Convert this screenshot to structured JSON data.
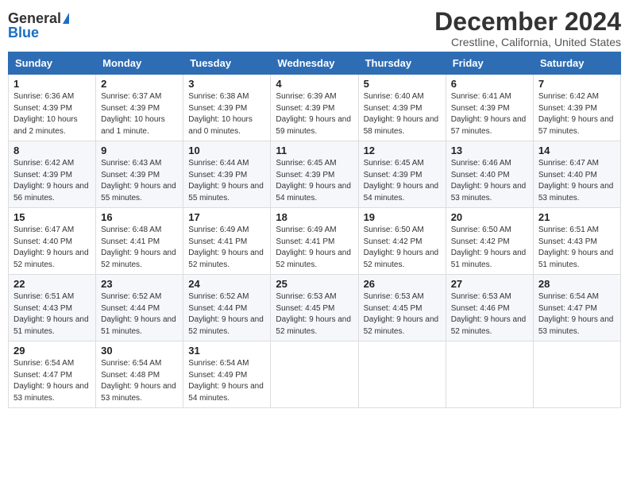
{
  "header": {
    "logo_general": "General",
    "logo_blue": "Blue",
    "month_title": "December 2024",
    "location": "Crestline, California, United States"
  },
  "days_of_week": [
    "Sunday",
    "Monday",
    "Tuesday",
    "Wednesday",
    "Thursday",
    "Friday",
    "Saturday"
  ],
  "weeks": [
    [
      {
        "day": 1,
        "sunrise": "6:36 AM",
        "sunset": "4:39 PM",
        "daylight": "10 hours and 2 minutes."
      },
      {
        "day": 2,
        "sunrise": "6:37 AM",
        "sunset": "4:39 PM",
        "daylight": "10 hours and 1 minute."
      },
      {
        "day": 3,
        "sunrise": "6:38 AM",
        "sunset": "4:39 PM",
        "daylight": "10 hours and 0 minutes."
      },
      {
        "day": 4,
        "sunrise": "6:39 AM",
        "sunset": "4:39 PM",
        "daylight": "9 hours and 59 minutes."
      },
      {
        "day": 5,
        "sunrise": "6:40 AM",
        "sunset": "4:39 PM",
        "daylight": "9 hours and 58 minutes."
      },
      {
        "day": 6,
        "sunrise": "6:41 AM",
        "sunset": "4:39 PM",
        "daylight": "9 hours and 57 minutes."
      },
      {
        "day": 7,
        "sunrise": "6:42 AM",
        "sunset": "4:39 PM",
        "daylight": "9 hours and 57 minutes."
      }
    ],
    [
      {
        "day": 8,
        "sunrise": "6:42 AM",
        "sunset": "4:39 PM",
        "daylight": "9 hours and 56 minutes."
      },
      {
        "day": 9,
        "sunrise": "6:43 AM",
        "sunset": "4:39 PM",
        "daylight": "9 hours and 55 minutes."
      },
      {
        "day": 10,
        "sunrise": "6:44 AM",
        "sunset": "4:39 PM",
        "daylight": "9 hours and 55 minutes."
      },
      {
        "day": 11,
        "sunrise": "6:45 AM",
        "sunset": "4:39 PM",
        "daylight": "9 hours and 54 minutes."
      },
      {
        "day": 12,
        "sunrise": "6:45 AM",
        "sunset": "4:39 PM",
        "daylight": "9 hours and 54 minutes."
      },
      {
        "day": 13,
        "sunrise": "6:46 AM",
        "sunset": "4:40 PM",
        "daylight": "9 hours and 53 minutes."
      },
      {
        "day": 14,
        "sunrise": "6:47 AM",
        "sunset": "4:40 PM",
        "daylight": "9 hours and 53 minutes."
      }
    ],
    [
      {
        "day": 15,
        "sunrise": "6:47 AM",
        "sunset": "4:40 PM",
        "daylight": "9 hours and 52 minutes."
      },
      {
        "day": 16,
        "sunrise": "6:48 AM",
        "sunset": "4:41 PM",
        "daylight": "9 hours and 52 minutes."
      },
      {
        "day": 17,
        "sunrise": "6:49 AM",
        "sunset": "4:41 PM",
        "daylight": "9 hours and 52 minutes."
      },
      {
        "day": 18,
        "sunrise": "6:49 AM",
        "sunset": "4:41 PM",
        "daylight": "9 hours and 52 minutes."
      },
      {
        "day": 19,
        "sunrise": "6:50 AM",
        "sunset": "4:42 PM",
        "daylight": "9 hours and 52 minutes."
      },
      {
        "day": 20,
        "sunrise": "6:50 AM",
        "sunset": "4:42 PM",
        "daylight": "9 hours and 51 minutes."
      },
      {
        "day": 21,
        "sunrise": "6:51 AM",
        "sunset": "4:43 PM",
        "daylight": "9 hours and 51 minutes."
      }
    ],
    [
      {
        "day": 22,
        "sunrise": "6:51 AM",
        "sunset": "4:43 PM",
        "daylight": "9 hours and 51 minutes."
      },
      {
        "day": 23,
        "sunrise": "6:52 AM",
        "sunset": "4:44 PM",
        "daylight": "9 hours and 51 minutes."
      },
      {
        "day": 24,
        "sunrise": "6:52 AM",
        "sunset": "4:44 PM",
        "daylight": "9 hours and 52 minutes."
      },
      {
        "day": 25,
        "sunrise": "6:53 AM",
        "sunset": "4:45 PM",
        "daylight": "9 hours and 52 minutes."
      },
      {
        "day": 26,
        "sunrise": "6:53 AM",
        "sunset": "4:45 PM",
        "daylight": "9 hours and 52 minutes."
      },
      {
        "day": 27,
        "sunrise": "6:53 AM",
        "sunset": "4:46 PM",
        "daylight": "9 hours and 52 minutes."
      },
      {
        "day": 28,
        "sunrise": "6:54 AM",
        "sunset": "4:47 PM",
        "daylight": "9 hours and 53 minutes."
      }
    ],
    [
      {
        "day": 29,
        "sunrise": "6:54 AM",
        "sunset": "4:47 PM",
        "daylight": "9 hours and 53 minutes."
      },
      {
        "day": 30,
        "sunrise": "6:54 AM",
        "sunset": "4:48 PM",
        "daylight": "9 hours and 53 minutes."
      },
      {
        "day": 31,
        "sunrise": "6:54 AM",
        "sunset": "4:49 PM",
        "daylight": "9 hours and 54 minutes."
      },
      null,
      null,
      null,
      null
    ]
  ]
}
